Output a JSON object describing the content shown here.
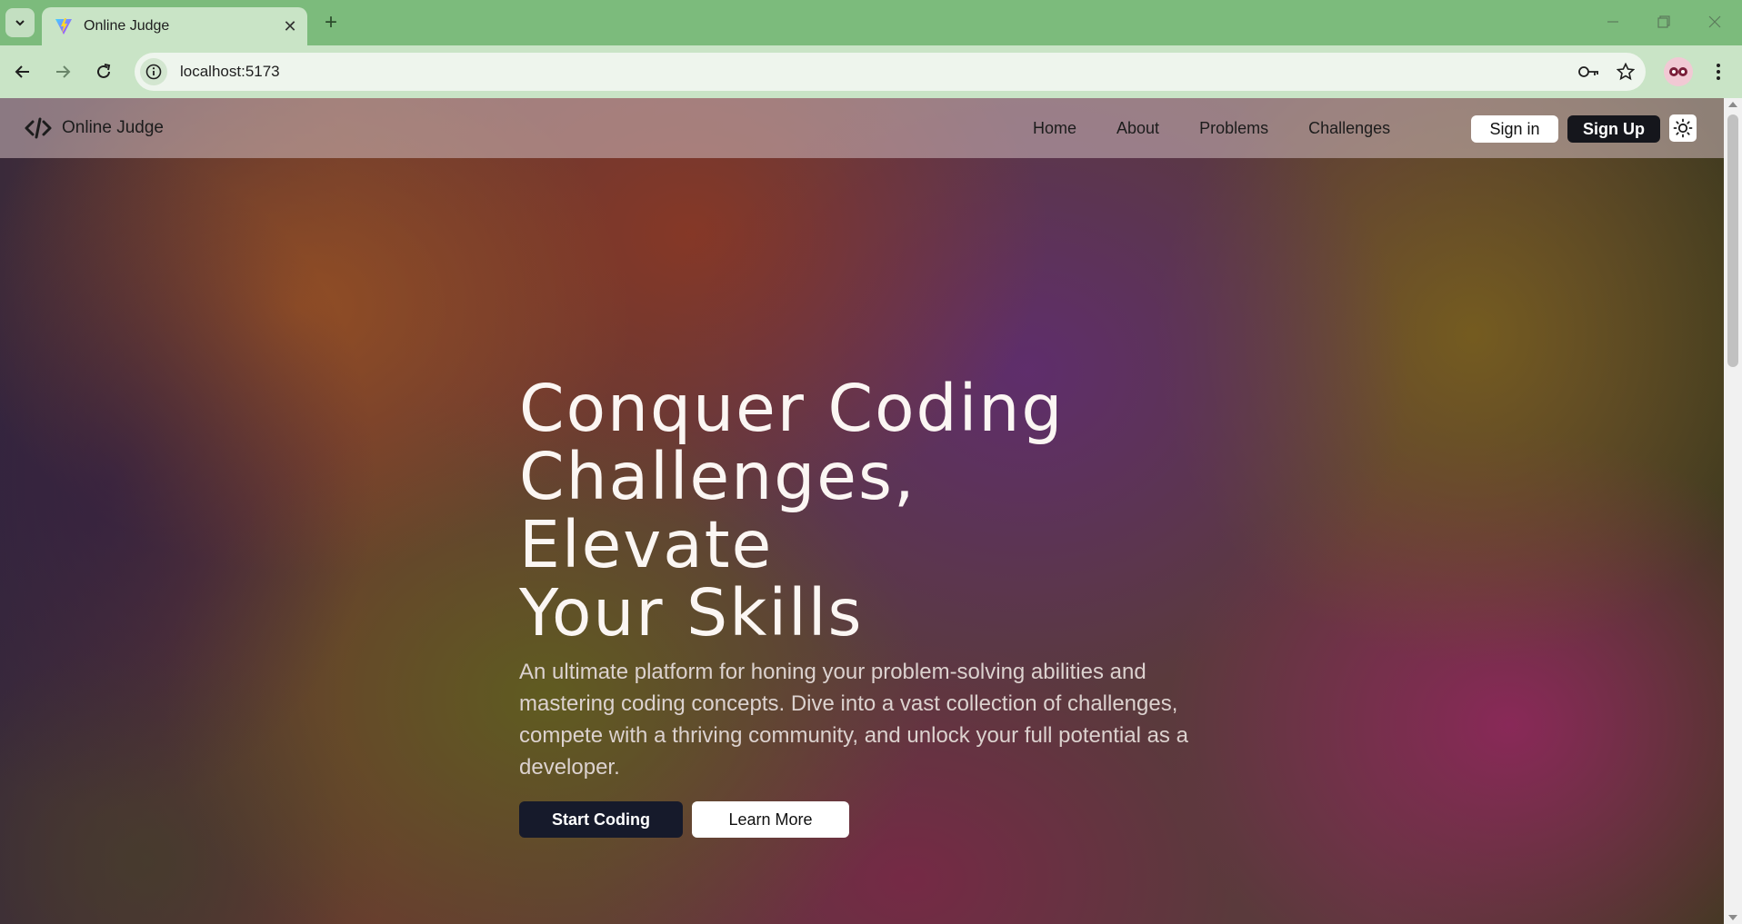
{
  "browser": {
    "tab_title": "Online Judge",
    "tab_close": "✕",
    "new_tab": "+",
    "url": "localhost:5173",
    "icons": [
      "tab-list-icon",
      "vite-favicon",
      "back-icon",
      "forward-icon",
      "reload-icon",
      "site-info-icon",
      "password-key-icon",
      "bookmark-star-icon",
      "profile-avatar",
      "menu-dots-icon",
      "minimize-icon",
      "restore-icon",
      "close-window-icon"
    ]
  },
  "app": {
    "brand": "Online Judge",
    "nav": [
      "Home",
      "About",
      "Problems",
      "Challenges"
    ],
    "sign_in": "Sign in",
    "sign_up": "Sign Up"
  },
  "hero": {
    "title_line1": "Conquer Coding",
    "title_line2": "Challenges, Elevate",
    "title_line3": "Your Skills",
    "subtitle": "An ultimate platform for honing your problem-solving abilities and mastering coding concepts. Dive into a vast collection of challenges, compete with a thriving community, and unlock your full potential as a developer.",
    "primary_cta": "Start Coding",
    "secondary_cta": "Learn More"
  },
  "colors": {
    "browser_frame": "#7cbb7c",
    "browser_toolbar": "#c9e4c6",
    "primary_button": "#161a2b",
    "signup_button": "#15161c"
  }
}
